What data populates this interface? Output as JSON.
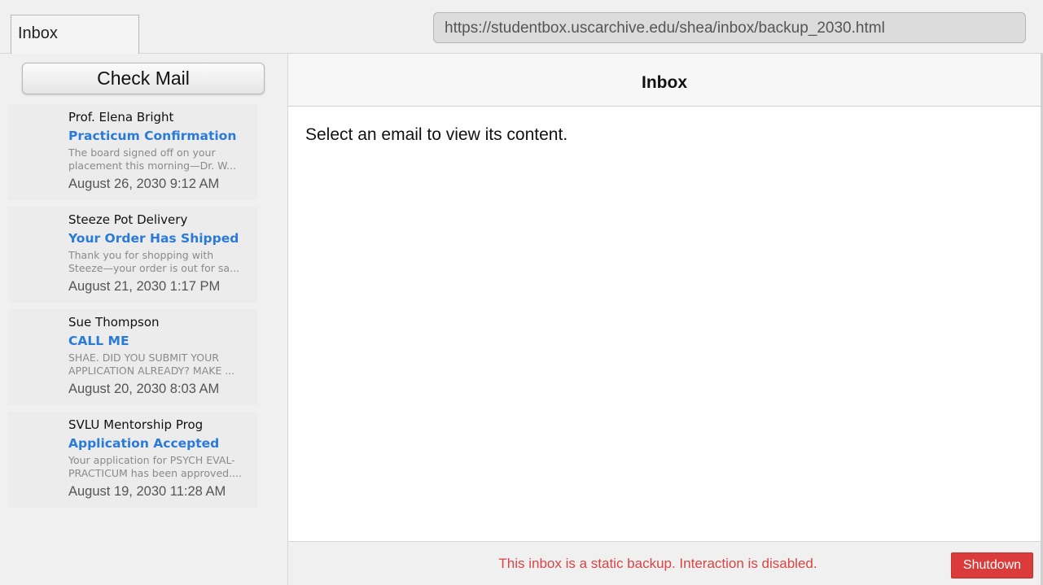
{
  "tab": {
    "label": "Inbox"
  },
  "address_bar": {
    "url": "https://studentbox.uscarchive.edu/shea/inbox/backup_2030.html"
  },
  "sidebar": {
    "check_mail_label": "Check Mail",
    "emails": [
      {
        "from": "Prof. Elena Bright",
        "subject": "Practicum Confirmation",
        "preview_line1": "The board signed off on your",
        "preview_line2": "placement this morning—Dr. W...",
        "date": "August 26, 2030 9:12 AM"
      },
      {
        "from": "Steeze Pot Delivery",
        "subject": "Your Order Has Shipped",
        "preview_line1": "Thank you for shopping with",
        "preview_line2": "Steeze—your order is out for sa...",
        "date": "August 21, 2030 1:17 PM"
      },
      {
        "from": "Sue Thompson",
        "subject": "CALL ME",
        "preview_line1": "SHAE. DID YOU SUBMIT YOUR",
        "preview_line2": "APPLICATION ALREADY? MAKE ...",
        "date": "August 20, 2030 8:03 AM"
      },
      {
        "from": "SVLU Mentorship Prog",
        "subject": "Application Accepted",
        "preview_line1": "Your application for PSYCH EVAL-",
        "preview_line2": "PRACTICUM has been approved....",
        "date": "August 19, 2030 11:28 AM"
      }
    ]
  },
  "main": {
    "header_title": "Inbox",
    "placeholder_text": "Select an email to view its content.",
    "footer_message": "This inbox is a static backup. Interaction is disabled.",
    "shutdown_label": "Shutdown"
  },
  "colors": {
    "accent_subject": "#2a7ad8",
    "warning_text": "#d94444",
    "shutdown_button": "#db3b3b"
  }
}
